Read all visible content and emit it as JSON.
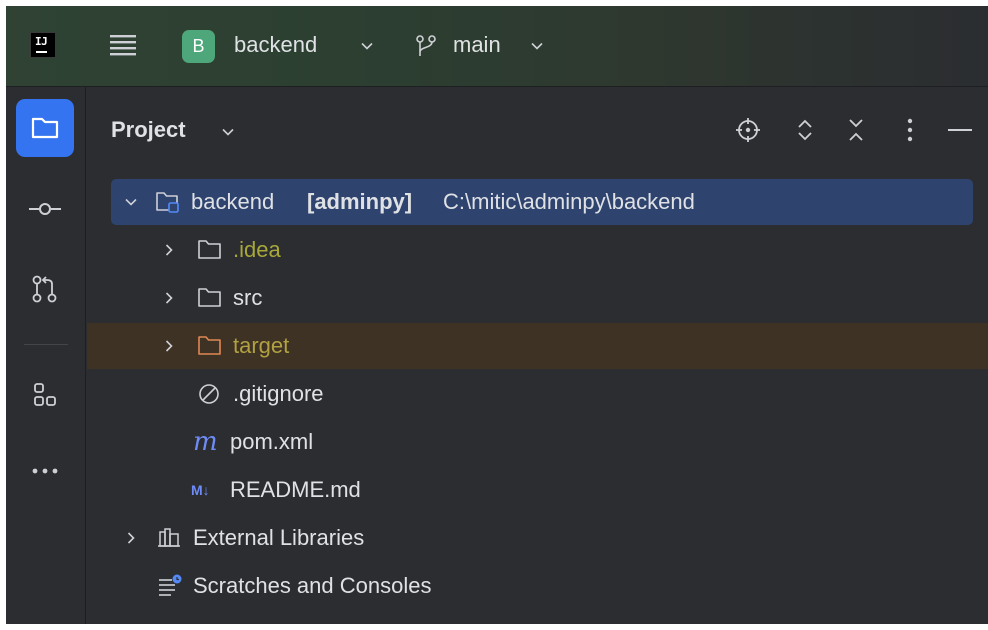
{
  "titlebar": {
    "logo_text": "IJ",
    "project_badge": "B",
    "project_name": "backend",
    "branch_name": "main",
    "accent_color": "#4ea77a"
  },
  "toolstrip": {
    "items": [
      {
        "name": "project",
        "icon": "folder-icon",
        "active": true
      },
      {
        "name": "commit",
        "icon": "commit-icon",
        "active": false
      },
      {
        "name": "pull-requests",
        "icon": "pull-request-icon",
        "active": false
      },
      {
        "name": "structure",
        "icon": "structure-icon",
        "active": false
      },
      {
        "name": "more",
        "icon": "more-icon",
        "active": false
      }
    ],
    "active_color": "#3574f0"
  },
  "panel": {
    "title": "Project",
    "actions": [
      "locate-icon",
      "expand-all-icon",
      "collapse-all-icon",
      "options-icon",
      "hide-icon"
    ]
  },
  "tree": {
    "root": {
      "name": "backend",
      "module": "[adminpy]",
      "path": "C:\\mitic\\adminpy\\backend"
    },
    "items": [
      {
        "label": ".idea",
        "type": "folder"
      },
      {
        "label": "src",
        "type": "folder"
      },
      {
        "label": "target",
        "type": "excluded-folder"
      },
      {
        "label": ".gitignore",
        "type": "ignore-file"
      },
      {
        "label": "pom.xml",
        "type": "maven-file"
      },
      {
        "label": "README.md",
        "type": "markdown-file"
      }
    ],
    "external_libraries": "External Libraries",
    "scratches": "Scratches and Consoles"
  }
}
